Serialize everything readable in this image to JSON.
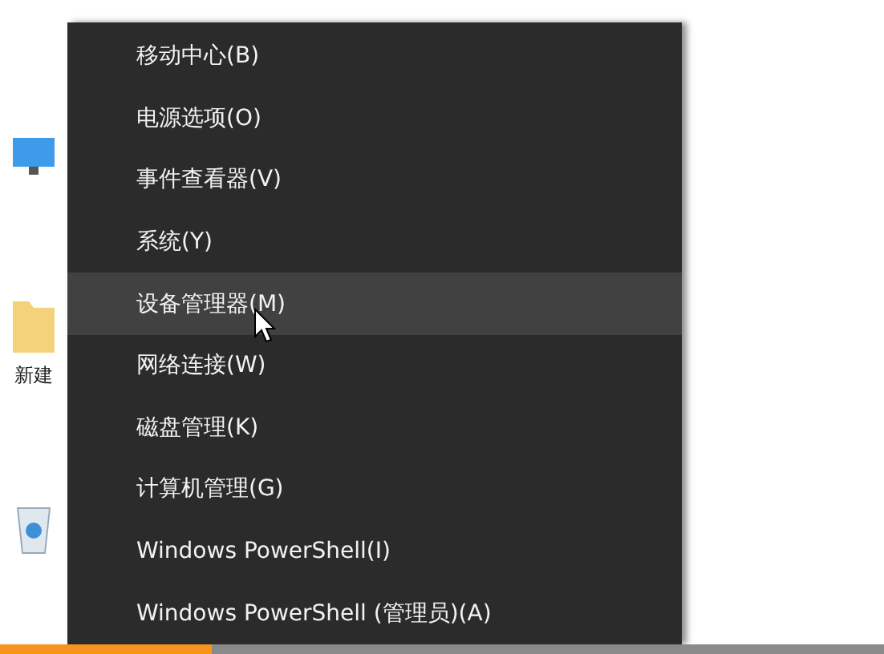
{
  "desktop": {
    "icons": [
      {
        "kind": "monitor"
      },
      {
        "kind": "folder",
        "label": "新建"
      },
      {
        "kind": "recycle"
      }
    ]
  },
  "menu": {
    "items": [
      {
        "label": "移动中心(B)",
        "selected": false
      },
      {
        "label": "电源选项(O)",
        "selected": false
      },
      {
        "label": "事件查看器(V)",
        "selected": false
      },
      {
        "label": "系统(Y)",
        "selected": false
      },
      {
        "label": "设备管理器(M)",
        "selected": true
      },
      {
        "label": "网络连接(W)",
        "selected": false
      },
      {
        "label": "磁盘管理(K)",
        "selected": false
      },
      {
        "label": "计算机管理(G)",
        "selected": false
      },
      {
        "label": "Windows PowerShell(I)",
        "selected": false
      },
      {
        "label": "Windows PowerShell (管理员)(A)",
        "selected": false
      }
    ]
  },
  "video_progress": {
    "level": 0.24
  }
}
